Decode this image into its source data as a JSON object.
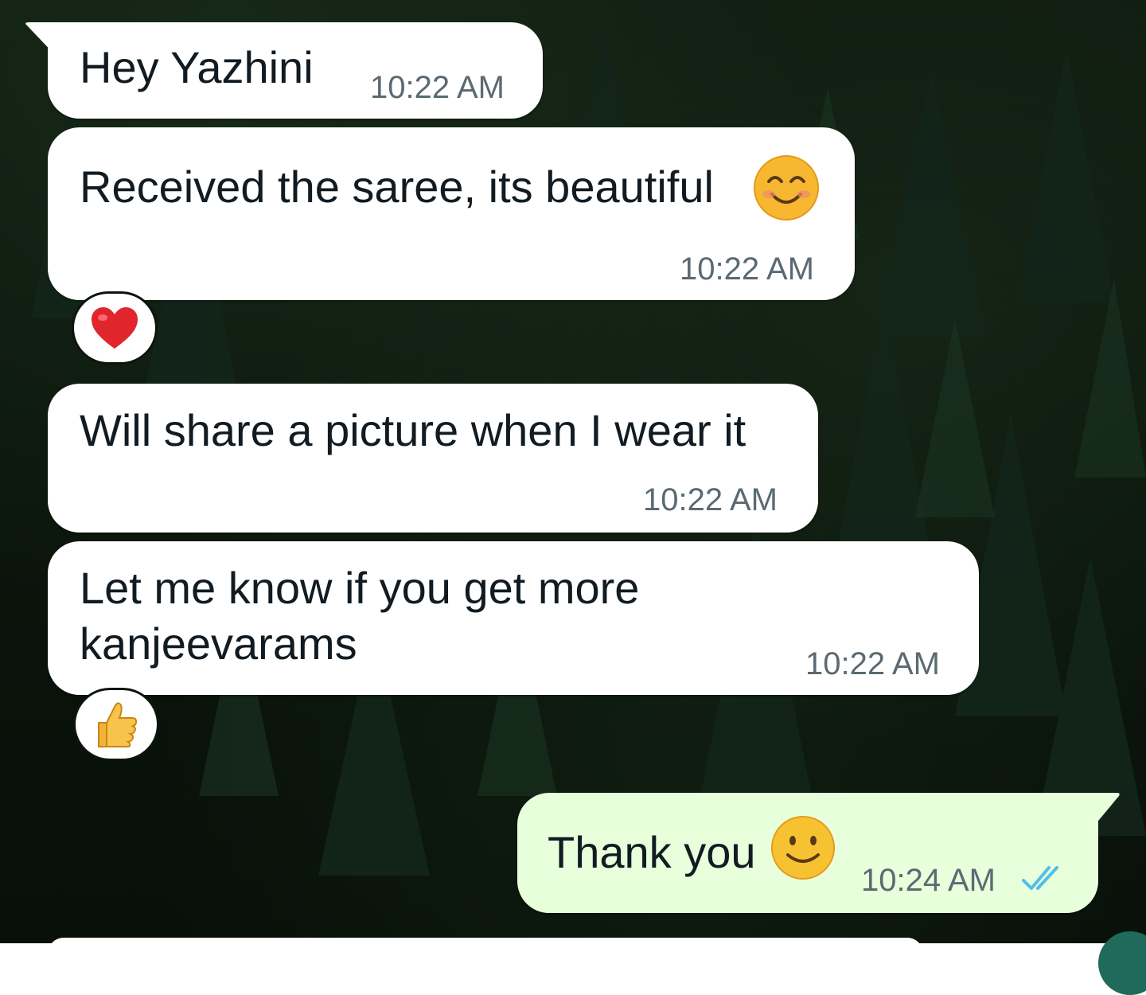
{
  "chat": {
    "messages": [
      {
        "text": "Hey Yazhini",
        "time": "10:22 AM",
        "direction": "incoming"
      },
      {
        "text": "Received the saree, its beautiful",
        "emoji": "smiling-face-with-smiling-eyes",
        "time": "10:22 AM",
        "direction": "incoming",
        "reaction": "heart"
      },
      {
        "text": "Will share a picture when I wear it",
        "time": "10:22 AM",
        "direction": "incoming"
      },
      {
        "text_line1": "Let me know if you get more",
        "text_line2": "kanjeevarams",
        "time": "10:22 AM",
        "direction": "incoming",
        "reaction": "thumbs-up"
      },
      {
        "text": "Thank you",
        "emoji": "slightly-smiling-face",
        "time": "10:24 AM",
        "direction": "outgoing",
        "status": "read-double-check"
      }
    ]
  },
  "colors": {
    "incoming_bubble": "#ffffff",
    "outgoing_bubble": "#e7ffdb",
    "read_ticks": "#53bdeb",
    "wallpaper": "#0b150c"
  }
}
